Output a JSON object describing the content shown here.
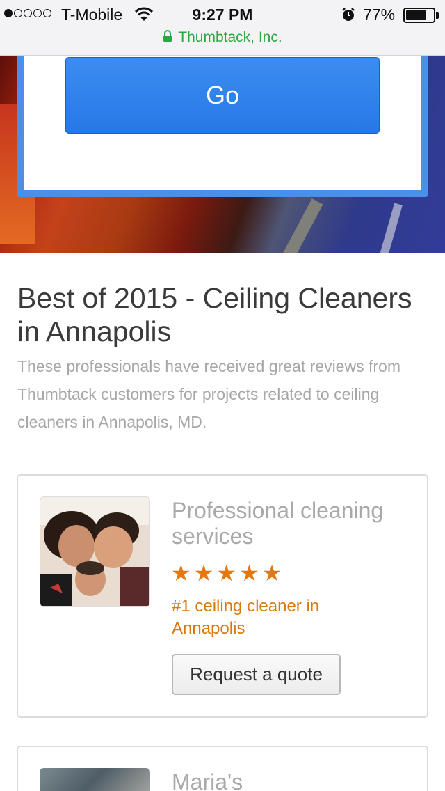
{
  "status_bar": {
    "carrier": "T-Mobile",
    "time": "9:27 PM",
    "battery_percent": "77%",
    "battery_level": 0.77,
    "signal_bars_filled": 1,
    "signal_bars_total": 5,
    "icons": [
      "wifi-icon",
      "alarm-icon",
      "battery-icon"
    ]
  },
  "browser": {
    "site_title": "Thumbtack, Inc.",
    "secure": true,
    "lock_icon": "lock-icon",
    "accent_color": "#2ba844"
  },
  "hero": {
    "go_button_label": "Go",
    "go_button_color": "#2f82ea"
  },
  "section": {
    "title": "Best of 2015 - Ceiling Cleaners in Annapolis",
    "description": "These professionals have received great reviews from Thumbtack customers for projects related to ceiling cleaners in Annapolis, MD."
  },
  "pros": [
    {
      "name": "Professional cleaning services",
      "rating": 5,
      "rank_text": "#1 ceiling cleaner in Annapolis",
      "cta_label": "Request a quote",
      "star_color": "#e5770d"
    },
    {
      "name": "Maria's"
    }
  ]
}
